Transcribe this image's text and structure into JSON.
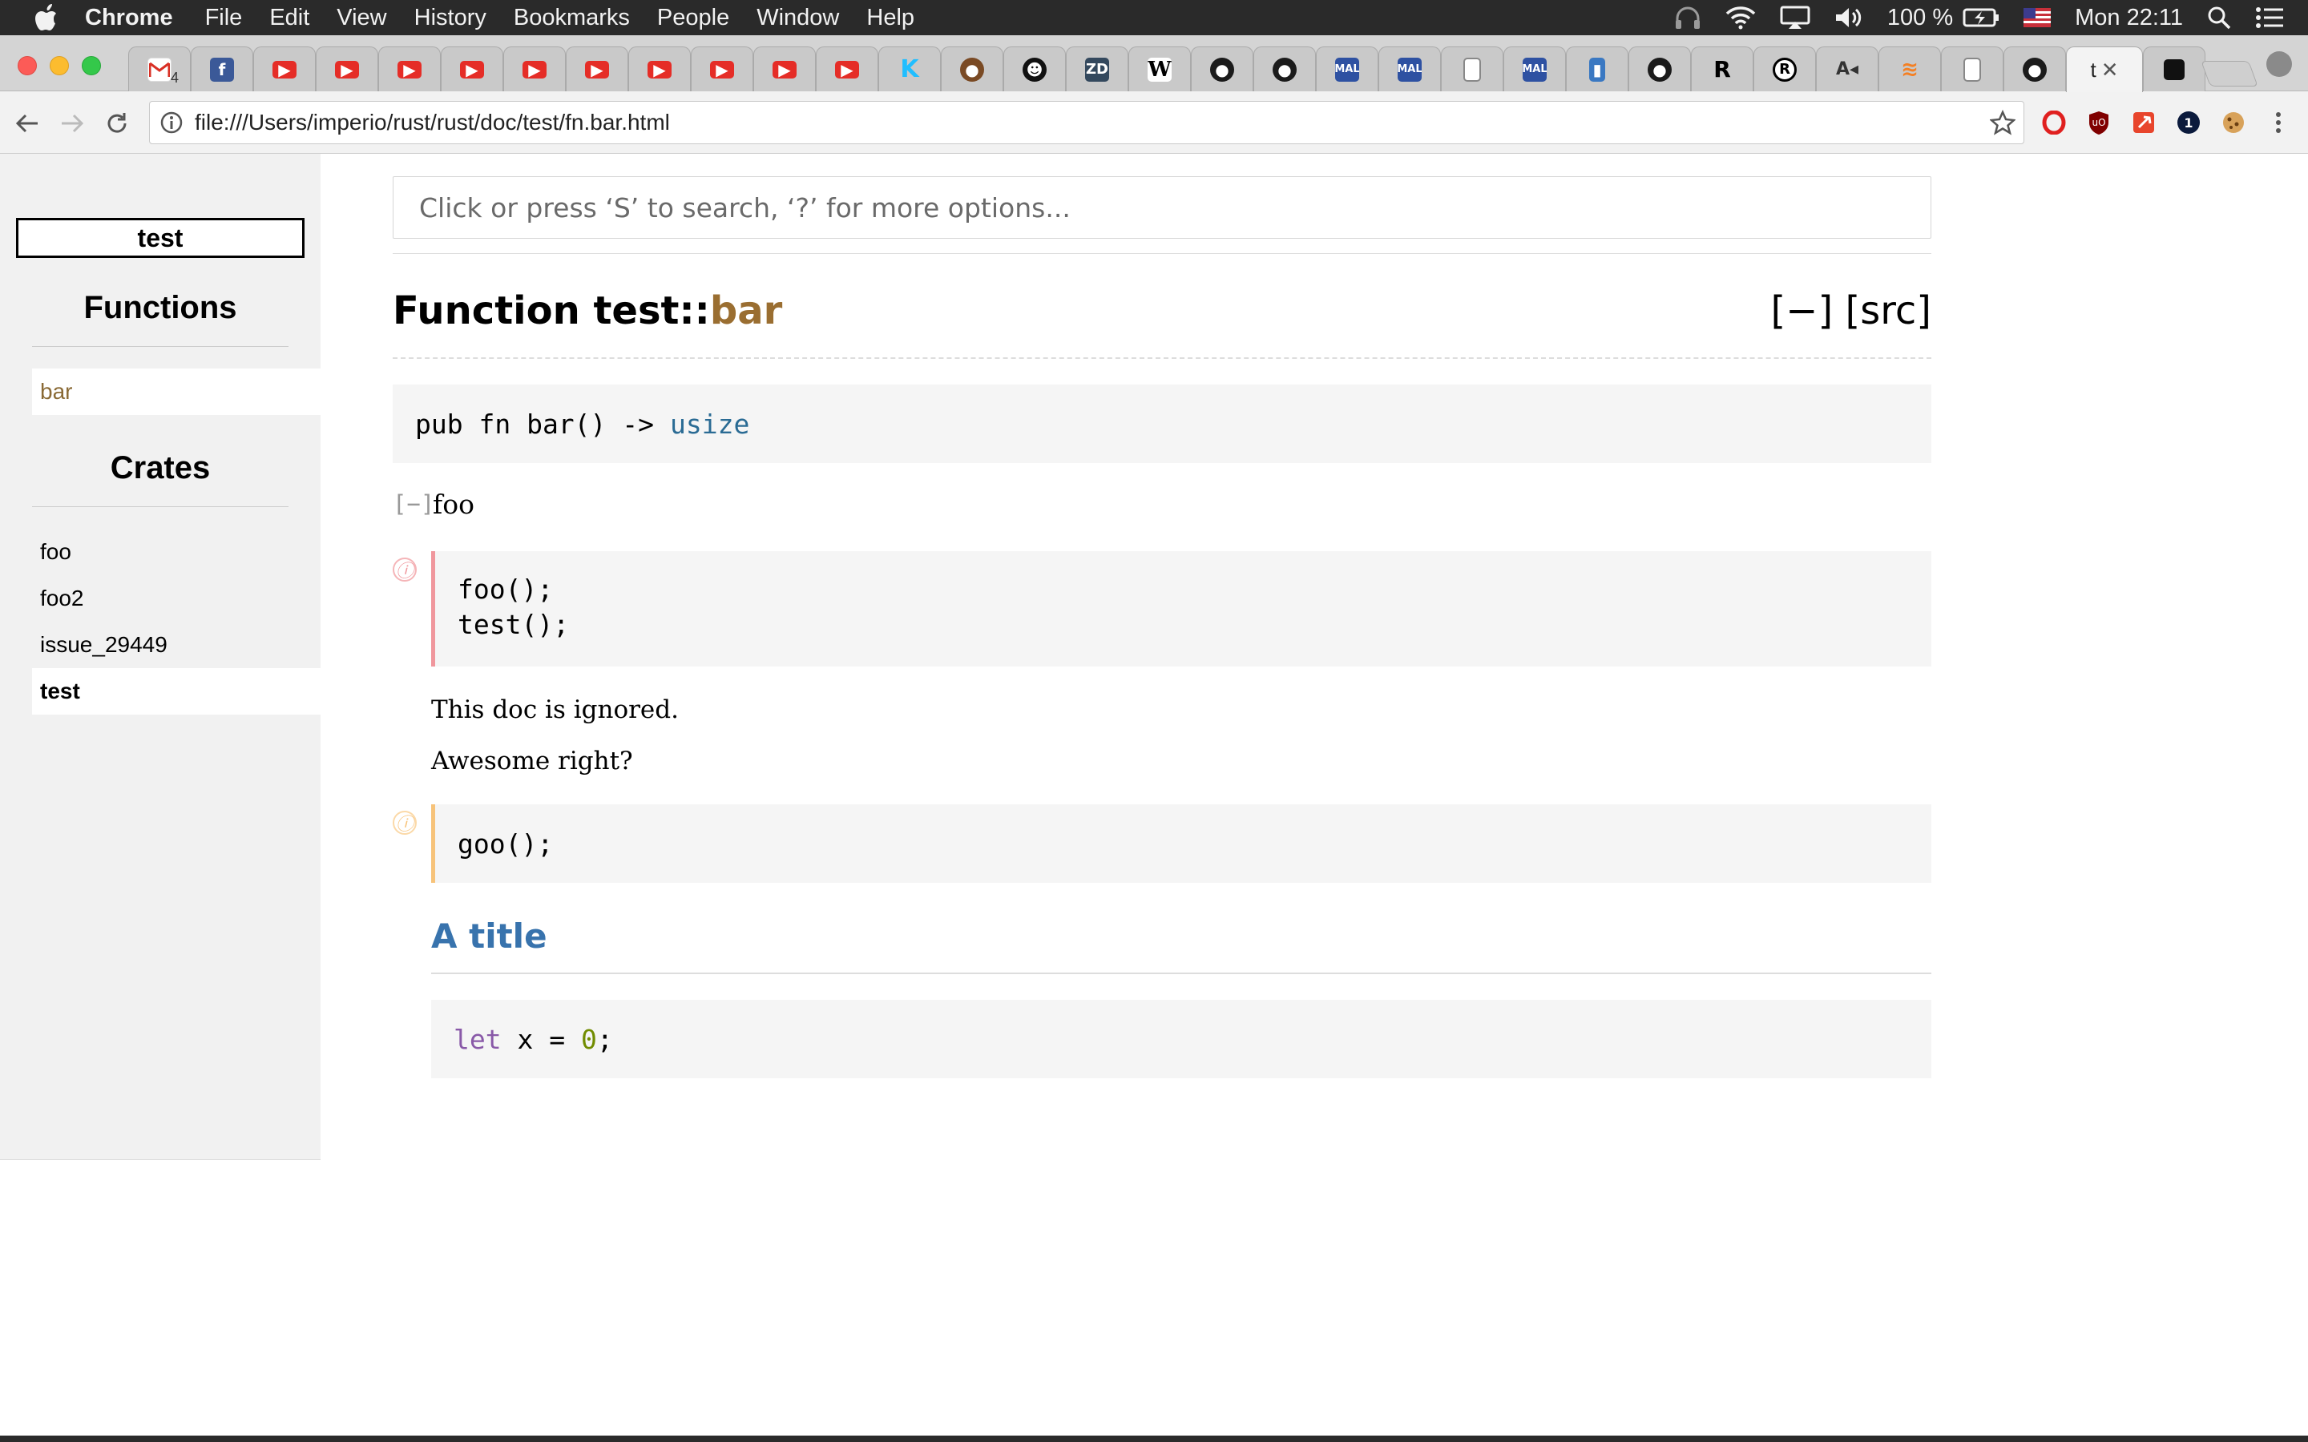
{
  "menubar": {
    "app": "Chrome",
    "items": [
      "File",
      "Edit",
      "View",
      "History",
      "Bookmarks",
      "People",
      "Window",
      "Help"
    ],
    "battery": "100 %",
    "clock": "Mon 22:11"
  },
  "tabs": {
    "favicons": [
      "gmail",
      "facebook",
      "youtube",
      "youtube",
      "youtube",
      "youtube",
      "youtube",
      "youtube",
      "youtube",
      "youtube",
      "youtube",
      "youtube",
      "kaggle",
      "poop",
      "face",
      "zd",
      "wikipedia",
      "github",
      "github",
      "mal",
      "mal",
      "document",
      "mal",
      "bookmark",
      "github",
      "rust-r",
      "rust-gear",
      "audio",
      "stackoverflow",
      "document",
      "github",
      "test-tab",
      "extension-tab"
    ],
    "gmail_count": "4",
    "active_label": "t"
  },
  "toolbar": {
    "url": "file:///Users/imperio/rust/rust/doc/test/fn.bar.html"
  },
  "sidebar": {
    "crate": "test",
    "functions_heading": "Functions",
    "functions": [
      "bar"
    ],
    "crates_heading": "Crates",
    "crates": [
      "foo",
      "foo2",
      "issue_29449",
      "test"
    ]
  },
  "main": {
    "search_placeholder": "Click or press ‘S’ to search, ‘?’ for more options...",
    "title_prefix": "Function test::",
    "title_name": "bar",
    "title_actions": "[−] [src]",
    "signature_code": "pub fn bar() ->",
    "signature_type": "usize",
    "toggle": "[−]",
    "doc_summary": "foo",
    "example1_lines": [
      "foo();",
      "test();"
    ],
    "para1": "This doc is ignored.",
    "para2": "Awesome right?",
    "example2_line": "goo();",
    "section_title": "A title",
    "example3_kw": "let",
    "example3_mid": " x = ",
    "example3_num": "0",
    "example3_end": ";"
  },
  "colors": {
    "fn_link": "#9a6e31",
    "type": "#2a6b94",
    "section_title": "#3873ad",
    "ignore_border": "#f0979d",
    "compile_fail_border": "#f7c37a"
  }
}
